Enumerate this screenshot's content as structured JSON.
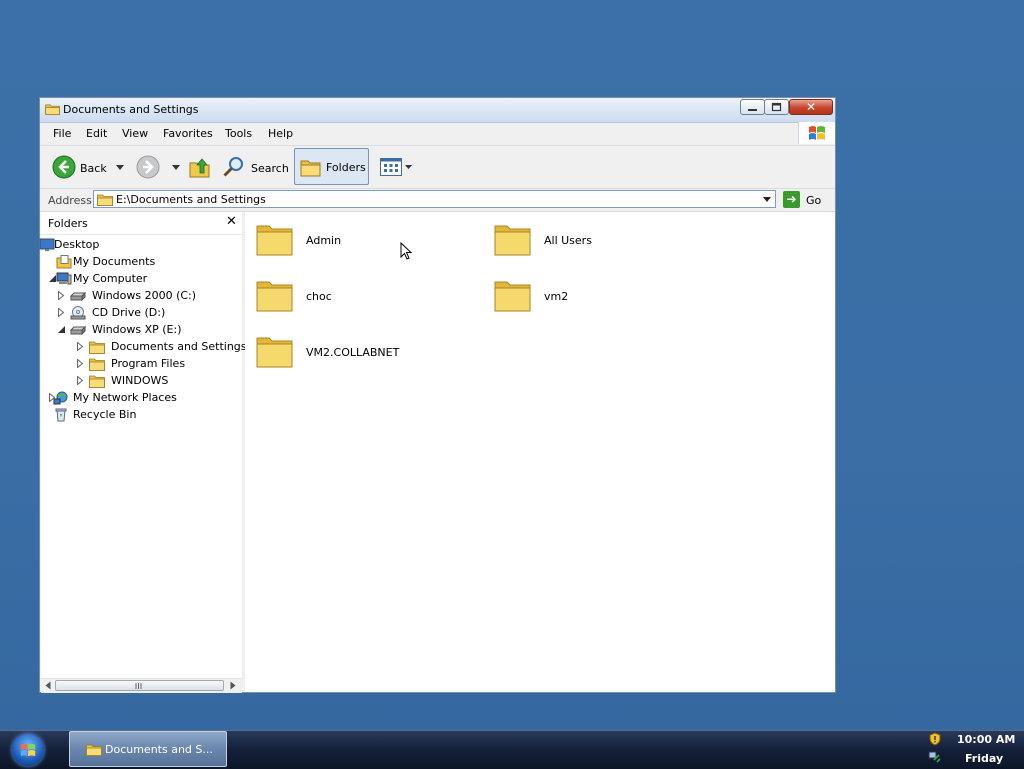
{
  "window": {
    "title": "Documents and Settings",
    "controls": {
      "minimize": "",
      "maximize": "",
      "close": "✕"
    }
  },
  "menu": [
    "File",
    "Edit",
    "View",
    "Favorites",
    "Tools",
    "Help"
  ],
  "toolbar": {
    "back": "Back",
    "search": "Search",
    "folders": "Folders"
  },
  "address": {
    "label": "Address",
    "value": "E:\\Documents and Settings",
    "go": "Go"
  },
  "folders_pane": {
    "title": "Folders",
    "tree": [
      {
        "label": "Desktop",
        "icon": "desktop-icon"
      },
      {
        "label": "My Documents",
        "icon": "my-documents-icon"
      },
      {
        "label": "My Computer",
        "icon": "my-computer-icon"
      },
      {
        "label": "Windows 2000 (C:)",
        "icon": "hard-drive-icon"
      },
      {
        "label": "CD Drive (D:)",
        "icon": "cd-drive-icon"
      },
      {
        "label": "Windows XP (E:)",
        "icon": "hard-drive-icon"
      },
      {
        "label": "Documents and Settings",
        "icon": "folder-icon"
      },
      {
        "label": "Program Files",
        "icon": "folder-icon"
      },
      {
        "label": "WINDOWS",
        "icon": "folder-icon"
      },
      {
        "label": "My Network Places",
        "icon": "network-places-icon"
      },
      {
        "label": "Recycle Bin",
        "icon": "recycle-bin-icon"
      }
    ]
  },
  "items": [
    {
      "name": "Admin"
    },
    {
      "name": "All Users"
    },
    {
      "name": "choc"
    },
    {
      "name": "vm2"
    },
    {
      "name": "VM2.COLLABNET"
    }
  ],
  "taskbar": {
    "task": "Documents and S...",
    "time": "10:00 AM",
    "day": "Friday"
  },
  "colors": {
    "desktop": "#3a6ea5",
    "folder": "#f5d76a",
    "go": "#3b9a2e"
  }
}
